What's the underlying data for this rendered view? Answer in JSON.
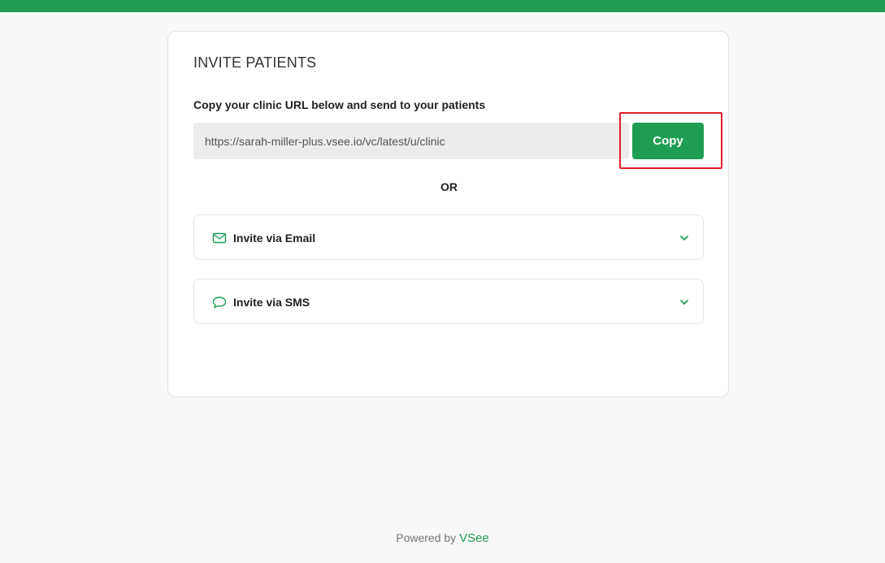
{
  "colors": {
    "brand_green": "#1f9d55",
    "highlight_red": "#e0202a",
    "page_background": "#f8f8f8"
  },
  "invite": {
    "title": "INVITE PATIENTS",
    "url_label": "Copy your clinic URL below and send to your patients",
    "clinic_url": "https://sarah-miller-plus.vsee.io/vc/latest/u/clinic",
    "copy_label": "Copy",
    "or_text": "OR",
    "options": [
      {
        "label": "Invite via Email",
        "icon": "envelope-icon",
        "expanded": false
      },
      {
        "label": "Invite via SMS",
        "icon": "chat-bubble-icon",
        "expanded": false
      }
    ]
  },
  "footer": {
    "powered_by": "Powered by",
    "brand": "VSee"
  }
}
